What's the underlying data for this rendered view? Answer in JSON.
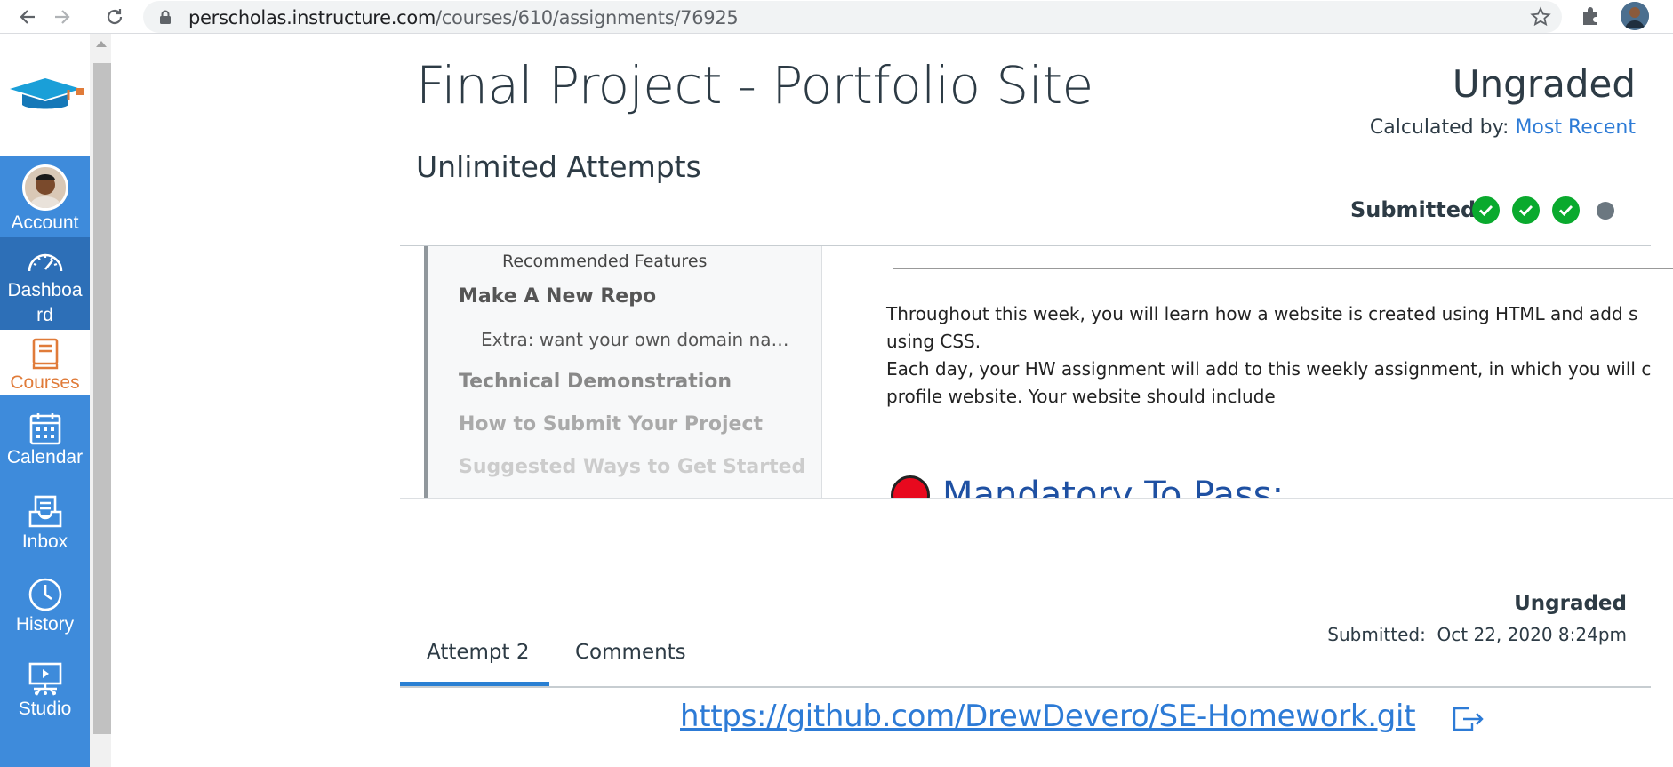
{
  "browser": {
    "url_host": "perscholas.instructure.com",
    "url_path": "/courses/610/assignments/76925"
  },
  "global_nav": {
    "items": [
      {
        "label": "Account",
        "icon": "account-avatar"
      },
      {
        "label": "Dashboa\nrd",
        "icon": "dashboard-icon"
      },
      {
        "label": "Courses",
        "icon": "courses-icon"
      },
      {
        "label": "Calendar",
        "icon": "calendar-icon"
      },
      {
        "label": "Inbox",
        "icon": "inbox-icon"
      },
      {
        "label": "History",
        "icon": "history-icon"
      },
      {
        "label": "Studio",
        "icon": "studio-icon"
      }
    ]
  },
  "assignment": {
    "title": "Final Project - Portfolio Site",
    "grade_status": "Ungraded",
    "calculated_by_label": "Calculated by:",
    "calculated_by_value": "Most Recent",
    "attempts": "Unlimited Attempts",
    "submitted_label": "Submitted",
    "steps": [
      "complete",
      "complete",
      "complete",
      "pending"
    ]
  },
  "preview": {
    "toc": [
      "Recommended Features",
      "Make A New Repo",
      "Extra: want your own domain na…",
      "Technical Demonstration",
      "How to Submit Your Project",
      "Suggested Ways to Get Started"
    ],
    "lines": [
      "Throughout this week, you will learn how a website is created using HTML and add s",
      "using CSS.",
      "Each day, your HW assignment will add to this weekly assignment, in which you will c",
      "profile website. Your website should include"
    ],
    "mandatory_heading": "Mandatory To Pass:"
  },
  "attempt": {
    "tabs": [
      "Attempt 2",
      "Comments"
    ],
    "grade": "Ungraded",
    "submitted_label": "Submitted:",
    "submitted_date": "Oct 22, 2020 8:24pm",
    "link": "https://github.com/DrewDevero/SE-Homework.git"
  },
  "colors": {
    "nav_blue": "#3e8bdb",
    "nav_active": "#2d6fb7",
    "courses_orange": "#e07b39",
    "success_green": "#0aaa2e",
    "link_blue": "#2d7bd6"
  }
}
